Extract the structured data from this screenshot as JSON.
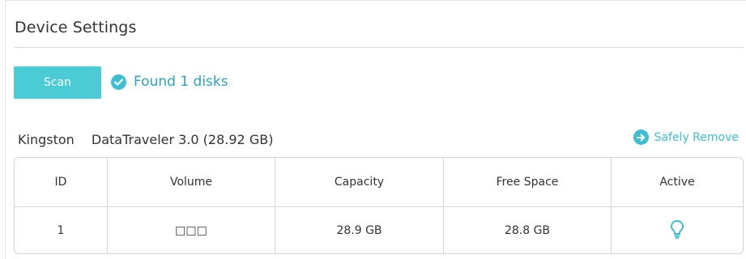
{
  "section": {
    "title": "Device Settings"
  },
  "scan": {
    "button_label": "Scan",
    "status_text": "Found 1 disks",
    "status_icon": "check-circle-icon"
  },
  "device": {
    "vendor": "Kingston",
    "model": "DataTraveler 3.0 (28.92 GB)",
    "safely_remove_label": "Safely Remove",
    "safely_remove_icon": "arrow-right-circle-icon"
  },
  "table": {
    "headers": {
      "id": "ID",
      "volume": "Volume",
      "capacity": "Capacity",
      "free_space": "Free Space",
      "active": "Active"
    },
    "rows": [
      {
        "id": "1",
        "volume": "□□□",
        "capacity": "28.9 GB",
        "free_space": "28.8 GB",
        "active_icon": "lightbulb-icon"
      }
    ]
  },
  "colors": {
    "accent": "#4acbd6",
    "link": "#3dbed2",
    "status_text": "#2aa3c0",
    "border": "#d4d4d4",
    "text": "#333333"
  }
}
